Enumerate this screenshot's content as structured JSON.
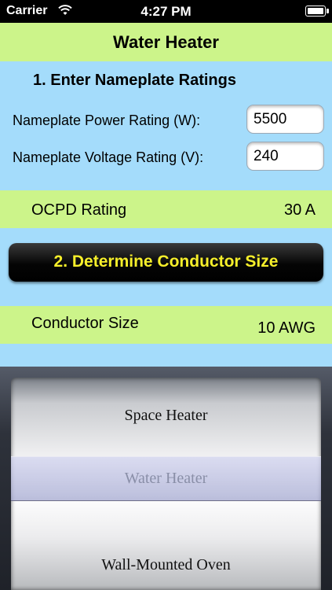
{
  "status": {
    "carrier": "Carrier",
    "time": "4:27 PM"
  },
  "header": {
    "title": "Water Heater"
  },
  "section1": {
    "heading": "1. Enter Nameplate Ratings",
    "power_label": "Nameplate Power Rating (W):",
    "power_value": "5500",
    "voltage_label": "Nameplate Voltage Rating (V):",
    "voltage_value": "240"
  },
  "ocpd": {
    "label": "OCPD Rating",
    "value": "30 A"
  },
  "section2": {
    "button_label": "2. Determine Conductor Size"
  },
  "conductor": {
    "label": "Conductor Size",
    "value": "10 AWG"
  },
  "picker": {
    "items": [
      "Space Heater",
      "Water Heater",
      "Wall-Mounted Oven"
    ],
    "selected": "Water Heater"
  },
  "colors": {
    "green_band": "#ccf48a",
    "blue_bg": "#a4dcfb",
    "button_text": "#f6ef2a"
  }
}
